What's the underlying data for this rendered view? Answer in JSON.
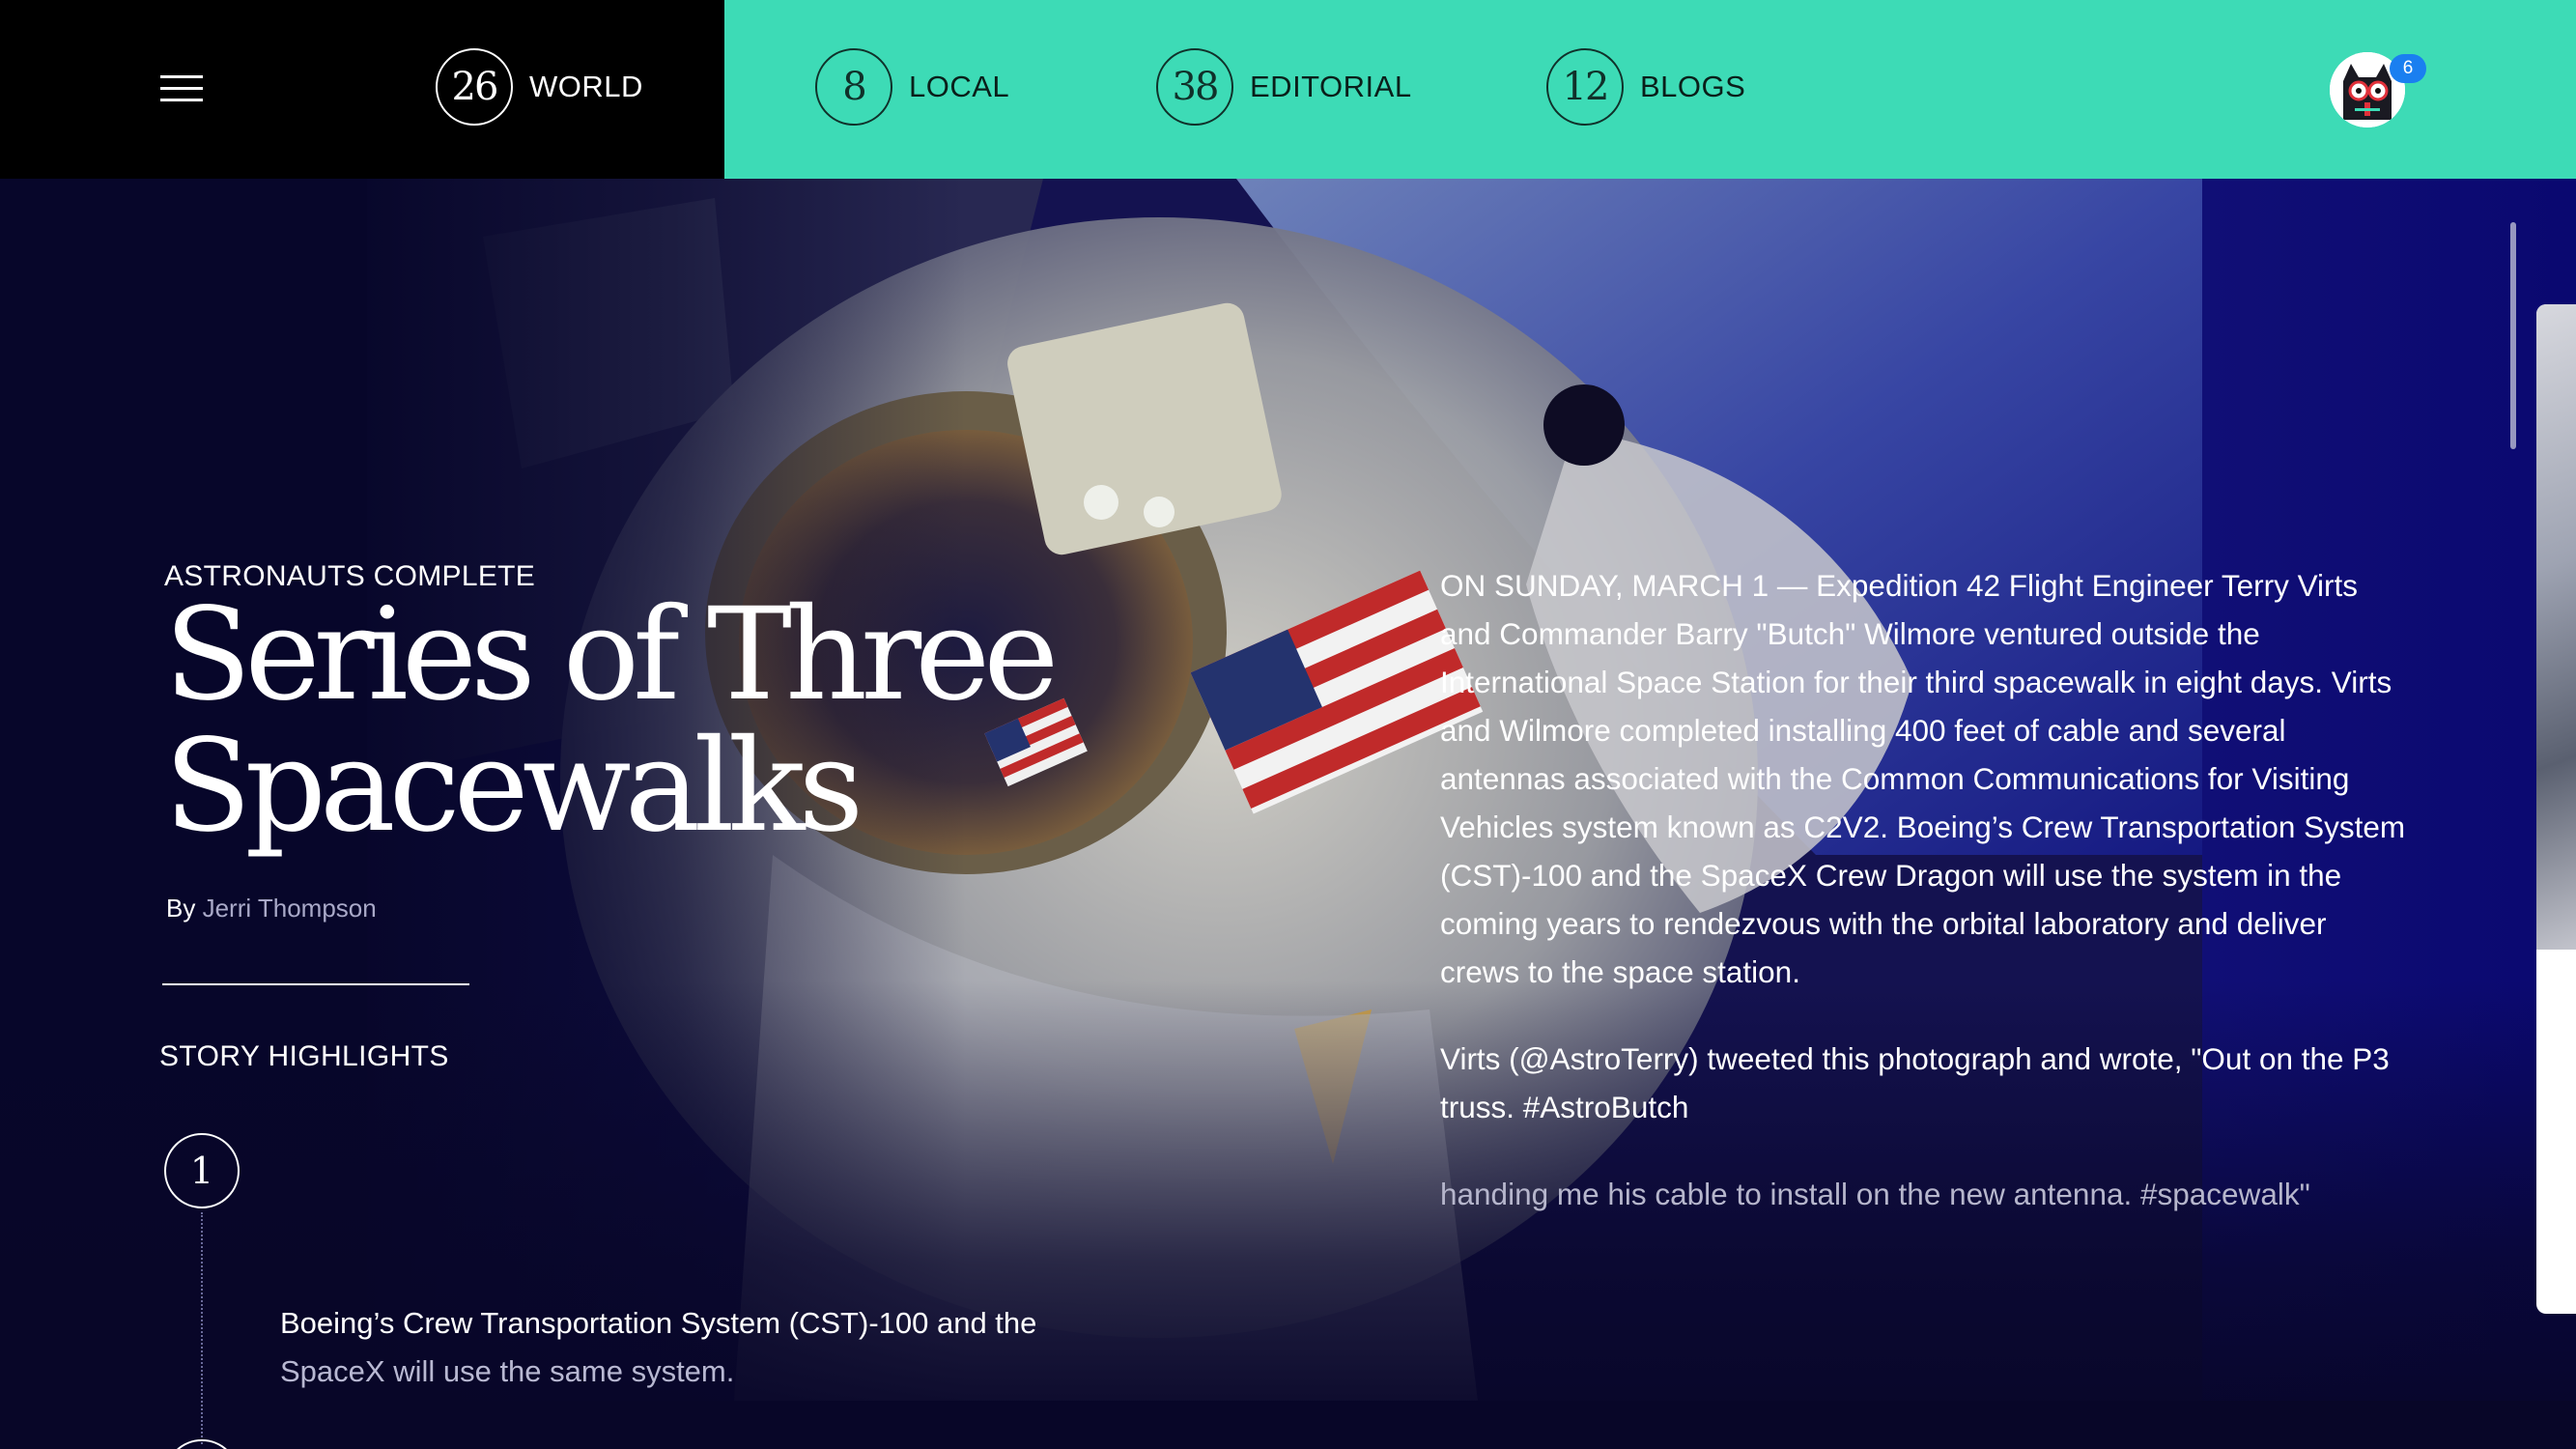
{
  "nav": {
    "items": [
      {
        "count": "26",
        "label": "WORLD"
      },
      {
        "count": "8",
        "label": "LOCAL"
      },
      {
        "count": "38",
        "label": "EDITORIAL"
      },
      {
        "count": "12",
        "label": "BLOGS"
      }
    ],
    "notification_count": "6"
  },
  "colors": {
    "accent": "#3ddbb6",
    "nav_dark": "#000000",
    "background": "#0a0a2e",
    "badge": "#1a7ff0"
  },
  "article": {
    "kicker": "ASTRONAUTS COMPLETE",
    "headline_line1": "Series of Three",
    "headline_line2": "Spacewalks",
    "byline_prefix": "By",
    "author": "Jerri Thompson",
    "highlights_title": "STORY HIGHLIGHTS",
    "highlights": [
      {
        "number": "1",
        "line1": "Boeing’s Crew Transportation System (CST)-100 and the",
        "line2": "SpaceX will use the same system."
      }
    ],
    "body": [
      "ON SUNDAY, MARCH 1 — Expedition 42 Flight Engineer Terry Virts and Commander Barry \"Butch\" Wilmore ventured outside the International Space Station for their third spacewalk in eight days. Virts and Wilmore completed installing 400 feet of cable and several antennas associated with the Common Communications for Visiting Vehicles system known as C2V2. Boeing’s Crew Transportation System (CST)-100 and the SpaceX Crew Dragon will use the system in the coming years to rendezvous with the orbital laboratory and deliver crews to the space station.",
      "Virts (@AstroTerry) tweeted this photograph and wrote, \"Out on the P3 truss. #AstroButch",
      "handing me his cable to install on the new antenna. #spacewalk\""
    ]
  }
}
